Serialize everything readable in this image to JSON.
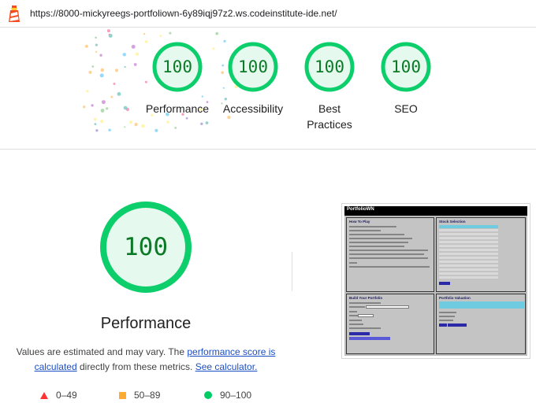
{
  "browser": {
    "url": "https://8000-mickyreegs-portfoliown-6y89iqj97z2.ws.codeinstitute-ide.net/"
  },
  "scores": [
    {
      "id": "performance",
      "label_line1": "Performance",
      "label_line2": "",
      "value": "100"
    },
    {
      "id": "accessibility",
      "label_line1": "Accessibility",
      "label_line2": "",
      "value": "100"
    },
    {
      "id": "best-practices",
      "label_line1": "Best",
      "label_line2": "Practices",
      "value": "100"
    },
    {
      "id": "seo",
      "label_line1": "SEO",
      "label_line2": "",
      "value": "100"
    }
  ],
  "performance_section": {
    "score": "100",
    "title": "Performance",
    "desc_part1": "Values are estimated and may vary. The ",
    "link_score": "performance score is calculated",
    "desc_part2": " directly from these metrics. ",
    "link_calc": "See calculator."
  },
  "legend": [
    {
      "range": "0–49",
      "color": "#ff3333",
      "shape": "triangle-icon"
    },
    {
      "range": "50–89",
      "color": "#ffaa33",
      "shape": "square-icon"
    },
    {
      "range": "90–100",
      "color": "#00cc66",
      "shape": "circle-icon"
    }
  ],
  "thumbnail": {
    "brand": "PortfolioWN",
    "panels": {
      "how_to": "How To Play",
      "stock": "Stock Selection",
      "build": "Build Your Portfolio",
      "valuation": "Portfolio Valuation"
    }
  },
  "colors": {
    "pass_green": "#0cce6b",
    "pass_bg": "#e6f9ee",
    "score_text": "#0a7a26",
    "link": "#1a4fc4"
  }
}
